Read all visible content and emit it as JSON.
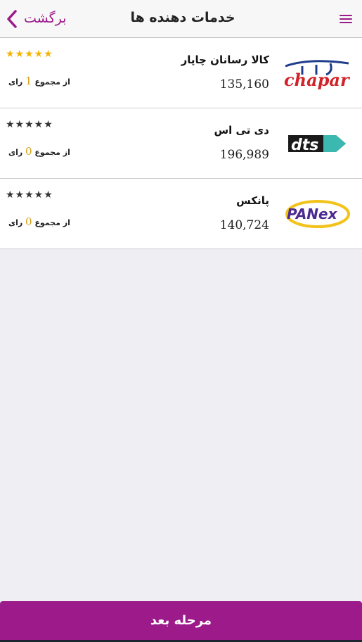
{
  "header": {
    "title": "خدمات دهنده ها",
    "back_label": "برگشت",
    "accent_color": "#9c1a8a",
    "menu_icon": "hamburger-menu-icon",
    "back_icon": "chevron-left-icon"
  },
  "providers": [
    {
      "name": "کالا رسانان چاپار",
      "price": "135,160",
      "logo": "chapar-logo",
      "logo_text": "chapar",
      "rating": 5,
      "stars_color": "#f5b301",
      "votes_prefix": "از مجموع",
      "votes_count": "1",
      "votes_suffix": "رای"
    },
    {
      "name": "دی تی اس",
      "price": "196,989",
      "logo": "dts-logo",
      "logo_text": "dts",
      "rating": 0,
      "stars_color": "#333333",
      "votes_prefix": "از مجموع",
      "votes_count": "0",
      "votes_suffix": "رای"
    },
    {
      "name": "پانکس",
      "price": "140,724",
      "logo": "panex-logo",
      "logo_text": "PANex",
      "rating": 0,
      "stars_color": "#333333",
      "votes_prefix": "از مجموع",
      "votes_count": "0",
      "votes_suffix": "رای"
    }
  ],
  "stars_text": "★★★★★",
  "footer": {
    "next_label": "مرحله بعد"
  }
}
